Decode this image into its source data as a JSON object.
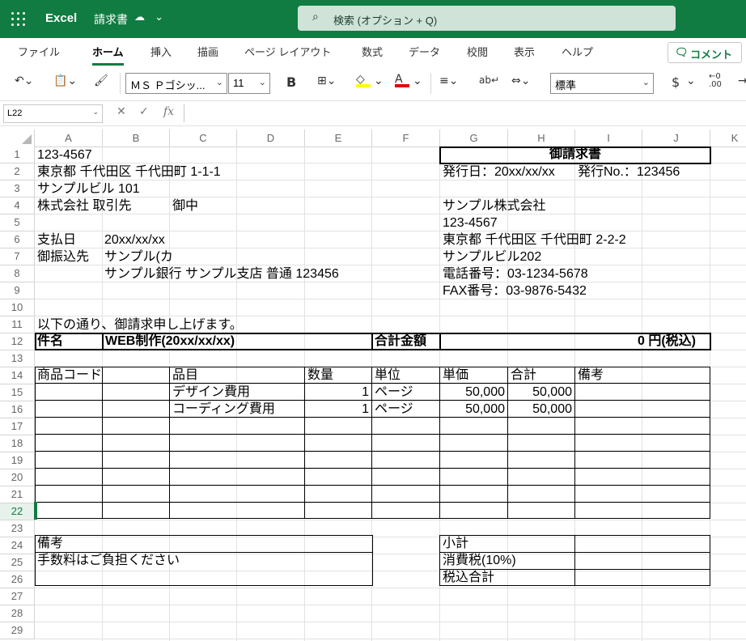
{
  "app": {
    "name": "Excel",
    "doc_title": "請求書"
  },
  "search": {
    "placeholder": "検索 (オプション + Q)"
  },
  "tabs": [
    "ファイル",
    "ホーム",
    "挿入",
    "描画",
    "ページ レイアウト",
    "数式",
    "データ",
    "校閲",
    "表示",
    "ヘルプ"
  ],
  "active_tab": "ホーム",
  "comment_button": "コメント",
  "toolbar": {
    "font_name": "ＭＳ Ｐゴシッ...",
    "font_size": "11",
    "bold": "B",
    "number_format": "標準",
    "currency": "$"
  },
  "formula_bar": {
    "name_box": "L22",
    "fx": "fx"
  },
  "columns": [
    "A",
    "B",
    "C",
    "D",
    "E",
    "F",
    "G",
    "H",
    "I",
    "J",
    "K"
  ],
  "rows": [
    "1",
    "2",
    "3",
    "4",
    "5",
    "6",
    "7",
    "8",
    "9",
    "10",
    "11",
    "12",
    "13",
    "14",
    "15",
    "16",
    "17",
    "18",
    "19",
    "20",
    "21",
    "22",
    "23",
    "24",
    "25",
    "26",
    "27",
    "28",
    "29"
  ],
  "active_row": "22",
  "sheet": {
    "postal": "123-4567",
    "address1": "東京都 千代田区 千代田町 1-1-1",
    "address2": "サンプルビル 101",
    "client": "株式会社 取引先",
    "honorific": "御中",
    "pay_date_label": "支払日",
    "pay_date": "20xx/xx/xx",
    "bank_label": "御振込先",
    "bank_name": "サンプル(カ",
    "bank_detail": "サンプル銀行 サンプル支店 普通 123456",
    "invoice_title": "御請求書",
    "issue_date": "発行日：20xx/xx/xx",
    "issue_no": "発行No.：123456",
    "company": "サンプル株式会社",
    "company_postal": "123-4567",
    "company_address1": "東京都 千代田区 千代田町 2-2-2",
    "company_address2": "サンプルビル202",
    "tel": "電話番号：03-1234-5678",
    "fax": "FAX番号：03-9876-5432",
    "intro": "以下の通り、御請求申し上げます。",
    "subject_label": "件名",
    "subject": "WEB制作(20xx/xx/xx)",
    "total_label": "合計金額",
    "total_value": "0 円(税込)",
    "table_headers": [
      "商品コード",
      "品目",
      "数量",
      "単位",
      "単価",
      "合計",
      "備考"
    ],
    "items": [
      {
        "name": "デザイン費用",
        "qty": "1",
        "unit": "ページ",
        "price": "50,000",
        "total": "50,000"
      },
      {
        "name": "コーディング費用",
        "qty": "1",
        "unit": "ページ",
        "price": "50,000",
        "total": "50,000"
      }
    ],
    "remarks_label": "備考",
    "remarks_text": "手数料はご負担ください",
    "subtotal_label": "小計",
    "tax_label": "消費税(10%)",
    "grand_total_label": "税込合計"
  }
}
